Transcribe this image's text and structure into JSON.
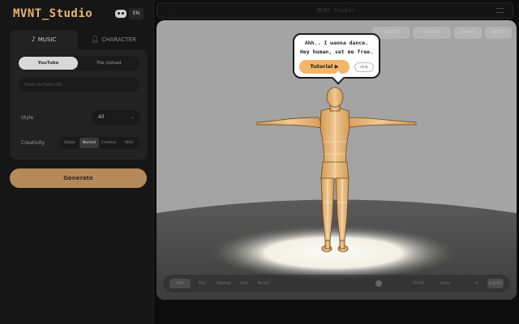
{
  "app": {
    "brand": "MVNT_Studio",
    "lang": "EN",
    "window_title": "MVNT_Studio",
    "back_label": "···"
  },
  "tabs": {
    "music": {
      "label": "MUSIC",
      "icon": "music-note-icon"
    },
    "character": {
      "label": "CHARACTER",
      "icon": "person-icon"
    }
  },
  "source": {
    "youtube": "YouTube",
    "file": "File Upload",
    "url_placeholder": "Paste YouTube URL"
  },
  "style": {
    "label": "Style",
    "value": "All"
  },
  "creativity": {
    "label": "Creativity",
    "options": [
      "Stable",
      "Normal",
      "Creative",
      "Wild"
    ],
    "selected": "Normal"
  },
  "generate_label": "Generate",
  "stage": {
    "toolbar": [
      "SELECT",
      "UPLOAD",
      "SHARE",
      "RESET"
    ],
    "bubble": {
      "line1": "Ahh.. I wanna dance.",
      "line2": "Hey human, set me free.",
      "tutorial": "Tutorial ▶",
      "skip": "skip"
    },
    "bottom": [
      "Idle",
      "Pop",
      "Hiphop",
      "Jazz",
      "Ballet"
    ],
    "bottom_right": [
      "00:00",
      "Loop",
      "Export"
    ]
  },
  "colors": {
    "accent": "#e6b470",
    "button": "#b5895a",
    "bubble_btn": "#f2b66a"
  }
}
